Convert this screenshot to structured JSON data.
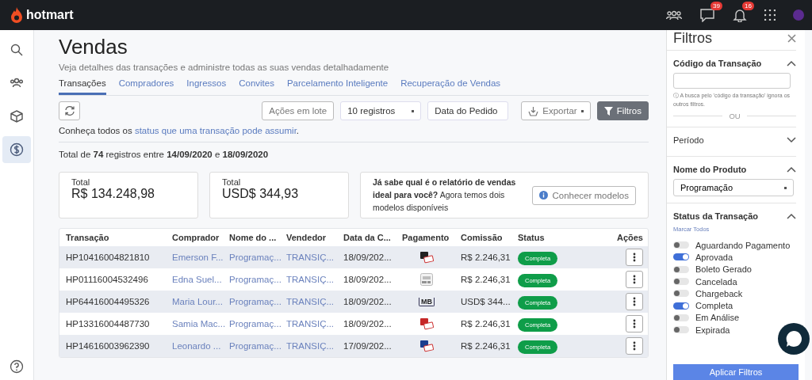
{
  "topbar": {
    "logo": "hotmart",
    "messages_badge": "39",
    "notifications_badge": "16"
  },
  "sidebar": {
    "items": [
      {
        "kind": "search",
        "selected": false
      },
      {
        "kind": "people",
        "selected": false
      },
      {
        "kind": "box",
        "selected": false
      },
      {
        "kind": "dollar",
        "selected": true
      }
    ]
  },
  "page": {
    "title": "Vendas",
    "subtitle": "Veja detalhes das transações e administre todas as suas vendas detalhadamente",
    "tabs": [
      {
        "label": "Transações",
        "selected": true
      },
      {
        "label": "Compradores",
        "selected": false
      },
      {
        "label": "Ingressos",
        "selected": false
      },
      {
        "label": "Convites",
        "selected": false
      },
      {
        "label": "Parcelamento Inteligente",
        "selected": false
      },
      {
        "label": "Recuperação de Vendas",
        "selected": false
      }
    ],
    "toolbar": {
      "batch_button": "Ações em lote",
      "records_select": "10 registros",
      "date_select": "Data do Pedido",
      "export_button": "Exportar",
      "filters_button": "Filtros"
    },
    "status_note": {
      "text": "Conheça todos os ",
      "link": "status que uma transação pode assumir",
      "end": "."
    },
    "total_line": "Total de **74** registros entre **14/09/2020** e **18/09/2020**",
    "cards": [
      {
        "label": "Total",
        "value": "R$ 134.248,98"
      },
      {
        "label": "Total",
        "value": "USD$ 344,93"
      }
    ],
    "promo": {
      "text": "**Já sabe qual é o relatório de vendas ideal para você?** Agora temos dois modelos disponíveis",
      "button": "Conhecer modelos"
    }
  },
  "table": {
    "columns": [
      "Transação",
      "Comprador",
      "Nome do ...",
      "Vendedor",
      "Data da C...",
      "Pagamento",
      "Comissão",
      "Status",
      "Ações"
    ],
    "rows": [
      {
        "transaction": "HP10416004821810",
        "buyer": "Emerson F...",
        "product": "Programaç...",
        "seller": "TRANSIÇ...",
        "date": "18/09/202...",
        "payment": {
          "kind": "card_dark"
        },
        "commission": "R$ 2.246,31",
        "status": "Completa"
      },
      {
        "transaction": "HP01116004532496",
        "buyer": "Edna Suel...",
        "product": "Programaç...",
        "seller": "TRANSIÇ...",
        "date": "18/09/202...",
        "payment": {
          "kind": "billet"
        },
        "commission": "R$ 2.246,31",
        "status": "Completa"
      },
      {
        "transaction": "HP64416004495326",
        "buyer": "Maria Lour...",
        "product": "Programaç...",
        "seller": "TRANSIÇ...",
        "date": "18/09/202...",
        "payment": {
          "kind": "multibanco",
          "label": "MB"
        },
        "commission": "USD$ 344...",
        "status": "Completa"
      },
      {
        "transaction": "HP13316004487730",
        "buyer": "Samia Mac...",
        "product": "Programaç...",
        "seller": "TRANSIÇ...",
        "date": "18/09/202...",
        "payment": {
          "kind": "card_red"
        },
        "commission": "R$ 2.246,31",
        "status": "Completa"
      },
      {
        "transaction": "HP14616003962390",
        "buyer": "Leonardo ...",
        "product": "Programaç...",
        "seller": "TRANSIÇ...",
        "date": "17/09/202...",
        "payment": {
          "kind": "card_blue"
        },
        "commission": "R$ 2.246,31",
        "status": "Completa"
      }
    ]
  },
  "filters": {
    "title": "Filtros",
    "transaction_code": {
      "title": "Código da Transação",
      "expanded": true,
      "hint": "ⓘ A busca pelo 'código da transação' ignora os outros filtros.",
      "separator": "OU"
    },
    "period": {
      "title": "Período",
      "expanded": false
    },
    "product": {
      "title": "Nome do Produto",
      "expanded": true,
      "value": "Programação"
    },
    "status": {
      "title": "Status da Transação",
      "expanded": true,
      "select_all": "Marcar Todos",
      "options": [
        {
          "label": "Aguardando Pagamento",
          "on": false
        },
        {
          "label": "Aprovada",
          "on": true
        },
        {
          "label": "Boleto Gerado",
          "on": false
        },
        {
          "label": "Cancelada",
          "on": false
        },
        {
          "label": "Chargeback",
          "on": false
        },
        {
          "label": "Completa",
          "on": true
        },
        {
          "label": "Em Análise",
          "on": false
        },
        {
          "label": "Expirada",
          "on": false
        }
      ]
    },
    "apply_button": "Aplicar Filtros"
  }
}
